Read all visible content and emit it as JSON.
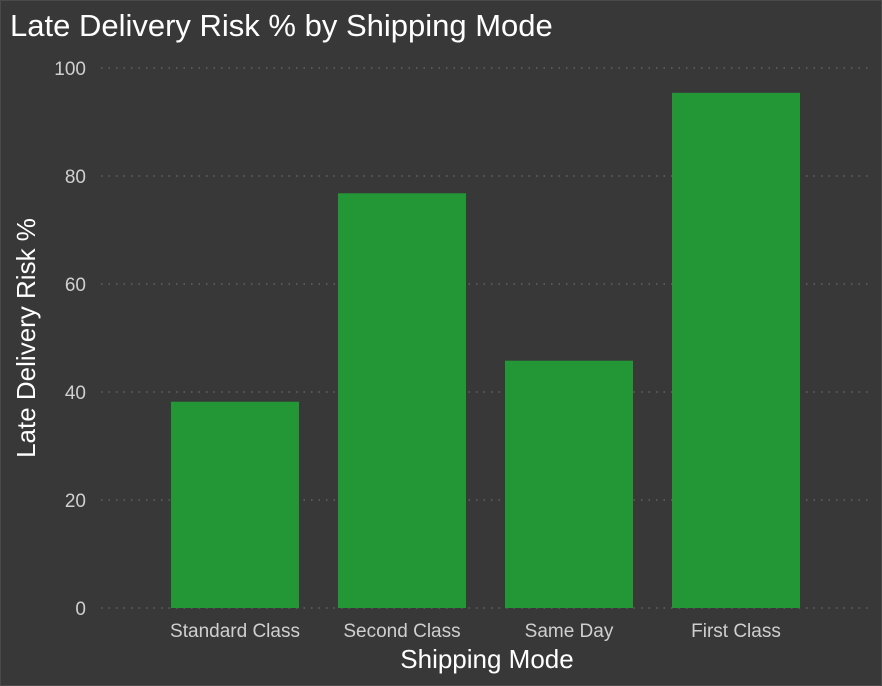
{
  "chart_data": {
    "type": "bar",
    "title": "Late Delivery Risk % by Shipping Mode",
    "xlabel": "Shipping Mode",
    "ylabel": "Late Delivery Risk %",
    "categories": [
      "Standard Class",
      "Second Class",
      "Same Day",
      "First Class"
    ],
    "values": [
      38.2,
      76.8,
      45.8,
      95.4
    ],
    "ylim": [
      0,
      100
    ],
    "yticks": [
      "0",
      "20",
      "40",
      "60",
      "80",
      "100"
    ],
    "grid": true,
    "legend": "none",
    "colors": {
      "bar": "#239636",
      "background": "#383838",
      "gridline": "#6a6a6a",
      "text": "#ffffff",
      "tick_text": "#cfcfcf"
    }
  }
}
